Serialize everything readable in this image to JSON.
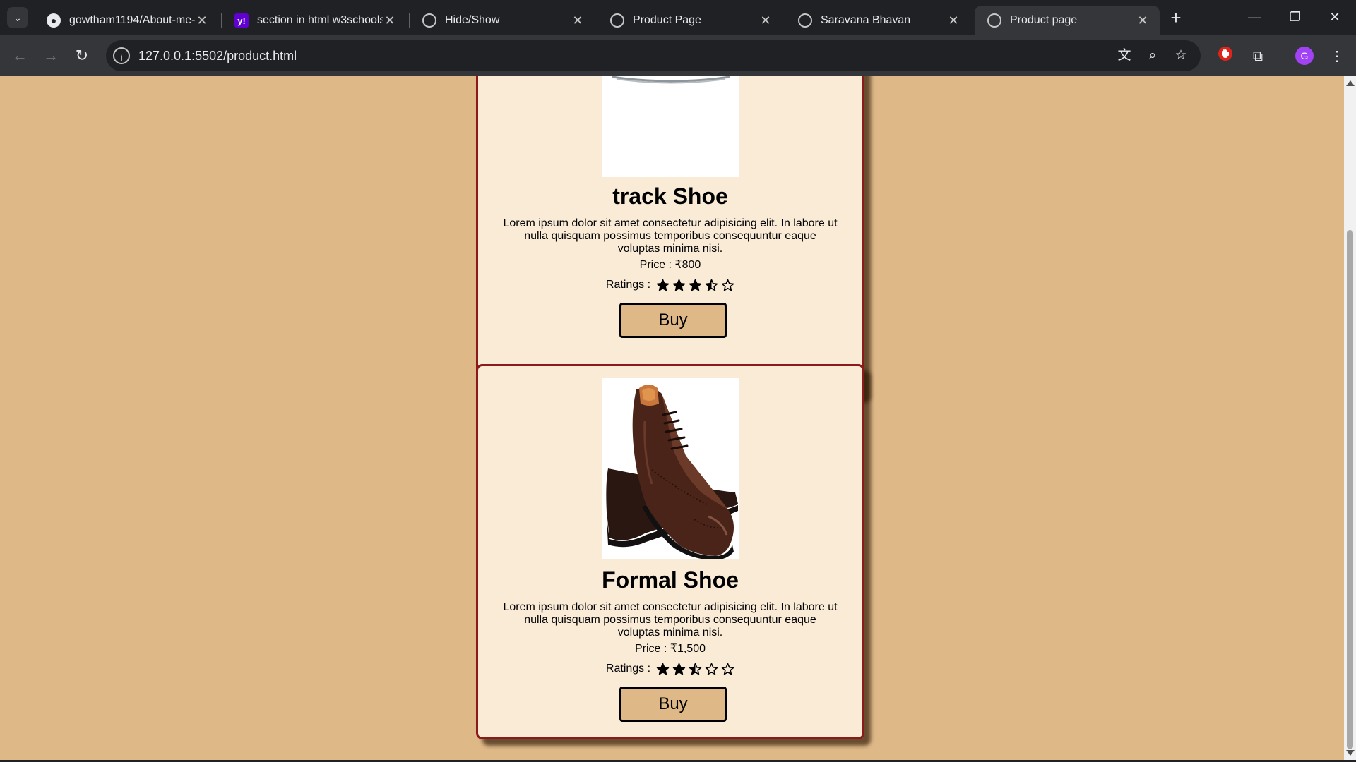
{
  "browser": {
    "tabs": [
      {
        "title": "gowtham1194/About-me-",
        "favicon": "github-icon",
        "active": false
      },
      {
        "title": "section in html w3schools",
        "favicon": "yahoo-icon",
        "active": false
      },
      {
        "title": "Hide/Show",
        "favicon": "globe-icon",
        "active": false
      },
      {
        "title": "Product Page",
        "favicon": "globe-icon",
        "active": false
      },
      {
        "title": "Saravana Bhavan",
        "favicon": "globe-icon",
        "active": false
      },
      {
        "title": "Product page",
        "favicon": "globe-icon",
        "active": true
      }
    ],
    "url": "127.0.0.1:5502/product.html",
    "profile_initial": "G"
  },
  "products": [
    {
      "name": "track Shoe",
      "description": "Lorem ipsum dolor sit amet consectetur adipisicing elit. In labore ut nulla quisquam possimus temporibus consequuntur eaque voluptas minima nisi.",
      "price_label": "Price : ₹800",
      "ratings_label": "Ratings :",
      "rating": 3.5,
      "rating_max": 5,
      "buy_label": "Buy"
    },
    {
      "name": "Formal Shoe",
      "description": "Lorem ipsum dolor sit amet consectetur adipisicing elit. In labore ut nulla quisquam possimus temporibus consequuntur eaque voluptas minima nisi.",
      "price_label": "Price : ₹1,500",
      "ratings_label": "Ratings :",
      "rating": 2.5,
      "rating_max": 5,
      "buy_label": "Buy"
    }
  ],
  "colors": {
    "page_background": "#deb887",
    "card_background": "#faebd7",
    "card_border": "#8b1a1a",
    "button_background": "#deb887"
  }
}
